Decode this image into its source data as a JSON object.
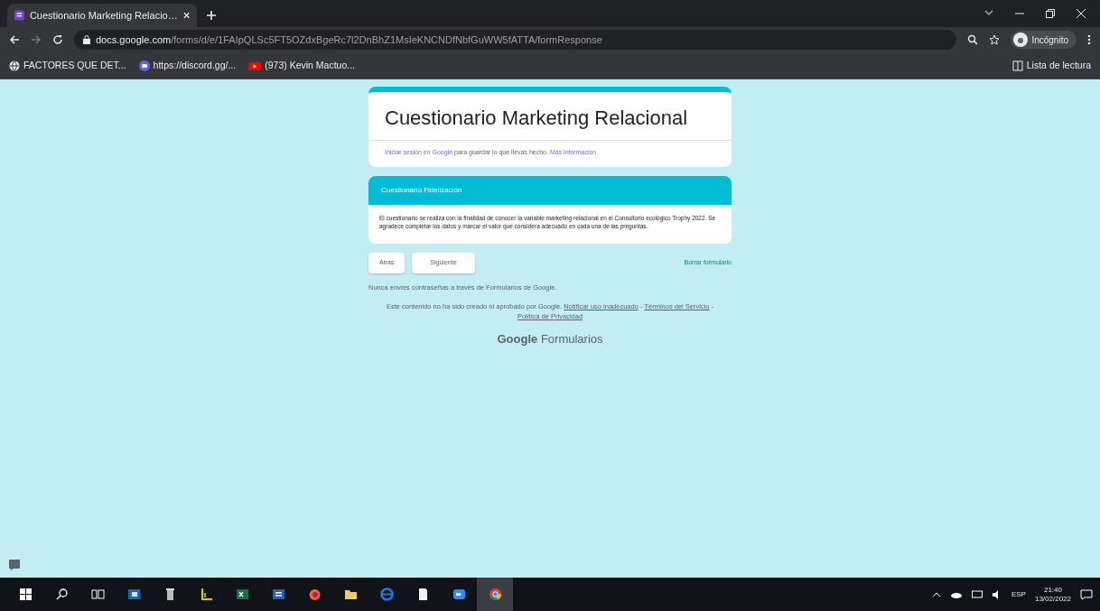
{
  "browser": {
    "tab": {
      "title": "Cuestionario Marketing Relacio…",
      "selected": true
    },
    "url": {
      "host": "docs.google.com",
      "path": "/forms/d/e/1FAIpQLSc5FT5OZdxBgeRc7l2DnBhZ1MsIeKNCNDfNbfGuWW5fATTA/formResponse"
    },
    "profile": "Incógnito",
    "bookmarks": [
      {
        "label": "FACTORES QUE DET...",
        "kind": "globe"
      },
      {
        "label": "https://discord.gg/...",
        "kind": "discord"
      },
      {
        "label": "(973) Kevin Mactuo...",
        "kind": "youtube"
      }
    ],
    "reading_list": "Lista de lectura"
  },
  "form": {
    "title": "Cuestionario Marketing Relacional",
    "signin": {
      "link": "Iniciar sesión en Google",
      "text": "para guardar lo que llevas hecho.",
      "more": "Más información"
    },
    "section": {
      "title": "Cuestionario Fidelización",
      "description": "El cuestionario se realiza con la finalidad de conocer la variable marketing relacional en el Consultorio ecológico Trophy 2022. Se agradece completar los datos y marcar el valor que considera adecuado en cada una de las preguntas."
    },
    "buttons": [
      "Atrás",
      "Siguiente"
    ],
    "clear": "Borrar formulario",
    "warning": "Nunca envíes contraseñas a través de Formularios de Google.",
    "footer": {
      "text": "Este contenido no ha sido creado ni aprobado por Google.",
      "links": [
        "Notificar uso inadecuado",
        "Términos del Servicio",
        "Política de Privacidad"
      ],
      "separator": "-"
    },
    "brand": {
      "google": "Google",
      "product": "Formularios"
    }
  },
  "taskbar": {
    "apps": [
      {
        "kind": "windows"
      },
      {
        "kind": "search"
      },
      {
        "kind": "taskview"
      },
      {
        "kind": "outlook"
      },
      {
        "kind": "trash"
      },
      {
        "kind": "chart"
      },
      {
        "kind": "excel"
      },
      {
        "kind": "word"
      },
      {
        "kind": "firefox"
      },
      {
        "kind": "folder"
      },
      {
        "kind": "edge"
      },
      {
        "kind": "file"
      },
      {
        "kind": "zoom"
      },
      {
        "kind": "chrome",
        "selected": true
      }
    ],
    "language": "ESP",
    "time": "21:40",
    "date": "13/02/2022"
  }
}
